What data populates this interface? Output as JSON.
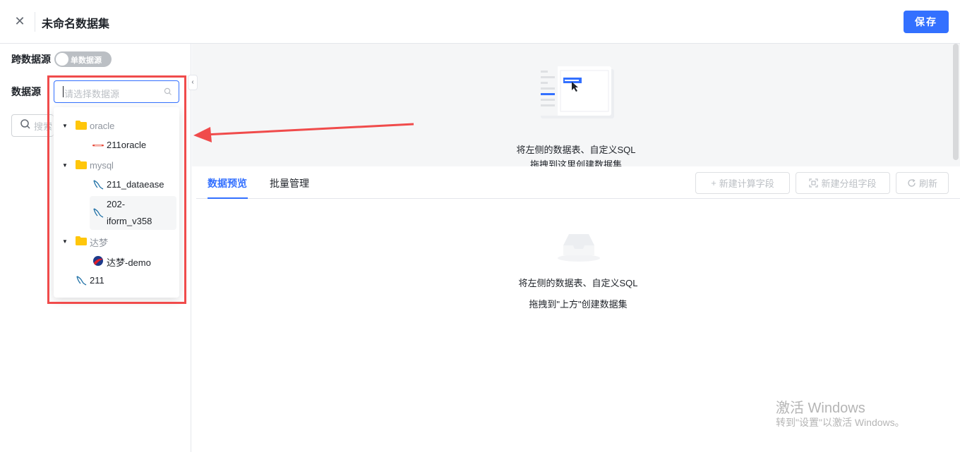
{
  "header": {
    "close_icon": "close-icon",
    "title": "未命名数据集",
    "save_label": "保存"
  },
  "left_panel": {
    "cross_source_label": "跨数据源",
    "switch_text": "单数据源",
    "switch_on": false,
    "datasource_label": "数据源",
    "search_placeholder": "搜索"
  },
  "datasource_select": {
    "placeholder": "请选择数据源",
    "tree": [
      {
        "label": "oracle",
        "type": "folder",
        "expanded": true,
        "children": [
          {
            "label": "211oracle",
            "icon": "oracle-icon"
          }
        ]
      },
      {
        "label": "mysql",
        "type": "folder",
        "expanded": true,
        "children": [
          {
            "label": "211_dataease",
            "icon": "mysql-icon"
          },
          {
            "label": "202-\niform_v358",
            "icon": "mysql-icon",
            "line1": "202-",
            "line2": "iform_v358"
          }
        ]
      },
      {
        "label": "达梦",
        "type": "folder",
        "expanded": true,
        "children": [
          {
            "label": "达梦-demo",
            "icon": "dameng-icon"
          }
        ]
      },
      {
        "label": "211",
        "type": "leaf",
        "icon": "mysql-icon"
      }
    ]
  },
  "drop_area": {
    "line1": "将左侧的数据表、自定义SQL",
    "line2": "拖拽到这里创建数据集"
  },
  "tabs": [
    {
      "label": "数据预览",
      "active": true
    },
    {
      "label": "批量管理",
      "active": false
    }
  ],
  "toolbar": {
    "new_calc_field": "新建计算字段",
    "new_group_field": "新建分组字段",
    "refresh": "刷新"
  },
  "empty_state": {
    "line1": "将左侧的数据表、自定义SQL",
    "line2": "拖拽到\"上方\"创建数据集"
  },
  "watermark": {
    "line1": "激活 Windows",
    "line2": "转到\"设置\"以激活 Windows。"
  },
  "colors": {
    "primary": "#3370ff",
    "folder": "#ffc60a",
    "annotation": "#f04b4b"
  }
}
